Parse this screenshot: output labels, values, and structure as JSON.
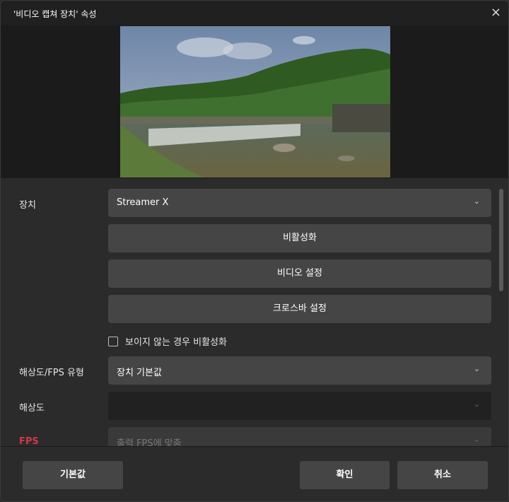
{
  "window": {
    "title": "'비디오 캡쳐 장치' 속성",
    "close_icon": "×"
  },
  "form": {
    "device_label": "장치",
    "device_value": "Streamer X",
    "deactivate_button": "비활성화",
    "video_settings_button": "비디오 설정",
    "crossbar_settings_button": "크로스바 설정",
    "deactivate_when_hidden": {
      "label": "보이지 않는 경우 비활성화",
      "checked": false
    },
    "res_fps_type_label": "해상도/FPS 유형",
    "res_fps_type_value": "장치 기본값",
    "resolution_label": "해상도",
    "resolution_value": "",
    "fps_label": "FPS",
    "fps_value": "출력 FPS에 맞춤"
  },
  "footer": {
    "defaults_button": "기본값",
    "ok_button": "확인",
    "cancel_button": "취소"
  },
  "chevron": "⌄"
}
